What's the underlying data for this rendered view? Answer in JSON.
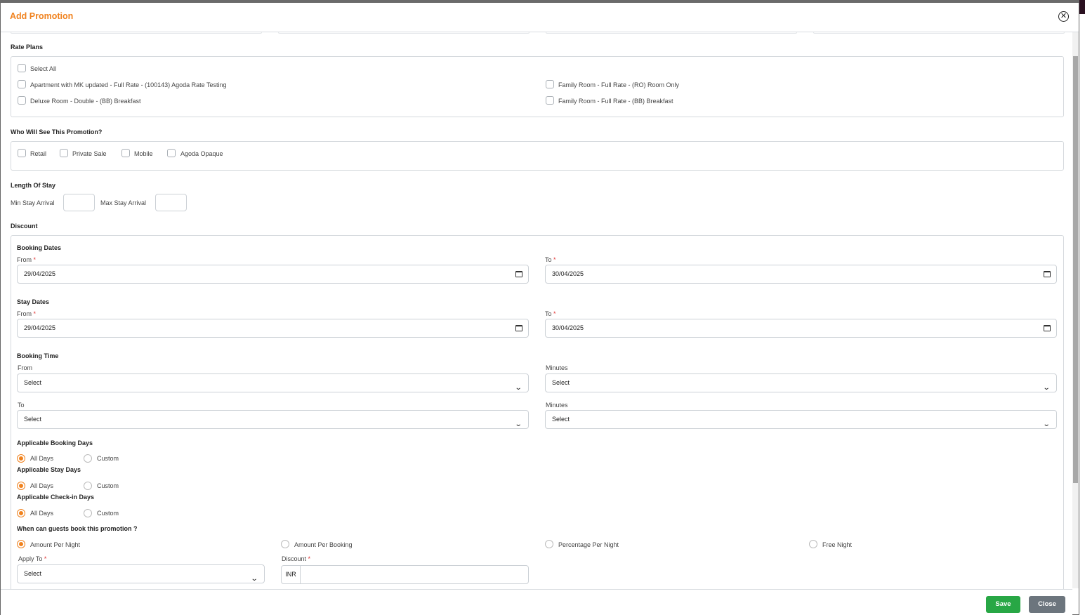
{
  "modal": {
    "title": "Add Promotion"
  },
  "rate_plans": {
    "heading": "Rate Plans",
    "select_all": "Select All",
    "items": [
      "Apartment with MK updated - Full Rate - (100143) Agoda Rate Testing",
      "Family Room - Full Rate - (RO) Room Only",
      "Deluxe Room - Double - (BB) Breakfast",
      "Family Room - Full Rate - (BB) Breakfast"
    ]
  },
  "visibility": {
    "heading": "Who Will See This Promotion?",
    "options": [
      "Retail",
      "Private Sale",
      "Mobile",
      "Agoda Opaque"
    ]
  },
  "length_of_stay": {
    "heading": "Length Of Stay",
    "min_label": "Min Stay Arrival",
    "max_label": "Max Stay Arrival",
    "min_value": "",
    "max_value": ""
  },
  "discount": {
    "heading": "Discount",
    "booking_dates": {
      "heading": "Booking Dates",
      "from_label": "From",
      "to_label": "To",
      "from": "29/04/2025",
      "to": "30/04/2025"
    },
    "stay_dates": {
      "heading": "Stay Dates",
      "from_label": "From",
      "to_label": "To",
      "from": "29/04/2025",
      "to": "30/04/2025"
    },
    "booking_time": {
      "heading": "Booking Time",
      "from_label": "From",
      "to_label": "To",
      "minutes_label": "Minutes",
      "from_value": "Select",
      "from_minutes": "Select",
      "to_value": "Select",
      "to_minutes": "Select"
    },
    "booking_days": {
      "heading": "Applicable Booking Days",
      "options": [
        "All Days",
        "Custom"
      ],
      "selected": "All Days"
    },
    "stay_days": {
      "heading": "Applicable Stay Days",
      "options": [
        "All Days",
        "Custom"
      ],
      "selected": "All Days"
    },
    "checkin_days": {
      "heading": "Applicable Check-in Days",
      "options": [
        "All Days",
        "Custom"
      ],
      "selected": "All Days"
    },
    "when": {
      "heading": "When can guests book this promotion ?",
      "options": [
        "Amount Per Night",
        "Amount Per Booking",
        "Percentage Per Night",
        "Free Night"
      ],
      "selected": "Amount Per Night"
    },
    "apply_to": {
      "label": "Apply To",
      "value": "Select"
    },
    "discount_field": {
      "label": "Discount",
      "currency": "INR",
      "value": ""
    }
  },
  "footer": {
    "save": "Save",
    "close": "Close"
  },
  "colors": {
    "accent": "#f0821e",
    "save": "#28a745",
    "close": "#6c757d"
  }
}
